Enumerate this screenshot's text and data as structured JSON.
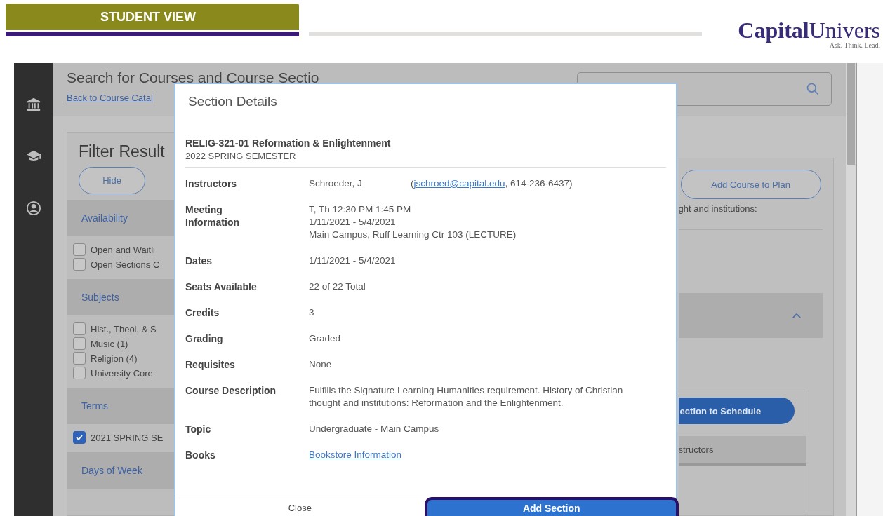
{
  "banner": {
    "label": "STUDENT VIEW"
  },
  "logo": {
    "name_a": "Capital",
    "name_b": "Univers",
    "tagline": "Ask. Think. Lead."
  },
  "page": {
    "title": "Search for Courses and Course Sectio",
    "back_link": "Back to Course Catal"
  },
  "filter": {
    "title": "Filter Result",
    "hide_button": "Hide",
    "groups": [
      {
        "heading": "Availability",
        "options": [
          {
            "label": "Open and Waitli",
            "checked": false
          },
          {
            "label": "Open Sections C",
            "checked": false
          }
        ]
      },
      {
        "heading": "Subjects",
        "options": [
          {
            "label": "Hist., Theol. & S",
            "checked": false
          },
          {
            "label": "Music (1)",
            "checked": false
          },
          {
            "label": "Religion (4)",
            "checked": false
          },
          {
            "label": "University Core",
            "checked": false
          }
        ]
      },
      {
        "heading": "Terms",
        "options": [
          {
            "label": "2021 SPRING SE",
            "checked": true
          }
        ]
      },
      {
        "heading": "Days of Week"
      }
    ]
  },
  "results": {
    "plan_button": "Add Course to Plan",
    "description_fragment": "ght and institutions:",
    "schedule_button": "ection to Schedule",
    "instructors_fragment": "structors"
  },
  "modal": {
    "title": "Section Details",
    "course": "RELIG-321-01 Reformation & Enlightenment",
    "term": "2022 SPRING SEMESTER",
    "rows": [
      {
        "kind": "instructor",
        "label": "Instructors",
        "name": "Schroeder, J",
        "contact_open": "(",
        "email": "jschroed@capital.edu",
        "phone": ", 614-236-6437)"
      },
      {
        "kind": "lines",
        "label": "Meeting Information",
        "lines": [
          "T, Th 12:30 PM 1:45 PM",
          "1/11/2021 - 5/4/2021",
          "Main Campus, Ruff Learning Ctr 103 (LECTURE)"
        ]
      },
      {
        "kind": "lines",
        "label": "Dates",
        "lines": [
          "1/11/2021 - 5/4/2021"
        ]
      },
      {
        "kind": "lines",
        "label": "Seats Available",
        "lines": [
          "22 of 22 Total"
        ]
      },
      {
        "kind": "lines",
        "label": "Credits",
        "lines": [
          "3"
        ]
      },
      {
        "kind": "lines",
        "label": "Grading",
        "lines": [
          "Graded"
        ]
      },
      {
        "kind": "lines",
        "label": "Requisites",
        "lines": [
          "None"
        ]
      },
      {
        "kind": "lines",
        "label": "Course Description",
        "lines": [
          "Fulfills the Signature Learning Humanities requirement. History of Christian thought and institutions: Reformation and the Enlightenment."
        ]
      },
      {
        "kind": "lines",
        "label": "Topic",
        "lines": [
          "Undergraduate - Main Campus"
        ]
      },
      {
        "kind": "link",
        "label": "Books",
        "link": "Bookstore Information"
      }
    ],
    "close_button": "Close",
    "add_button": "Add Section",
    "add_highlighted": true
  }
}
